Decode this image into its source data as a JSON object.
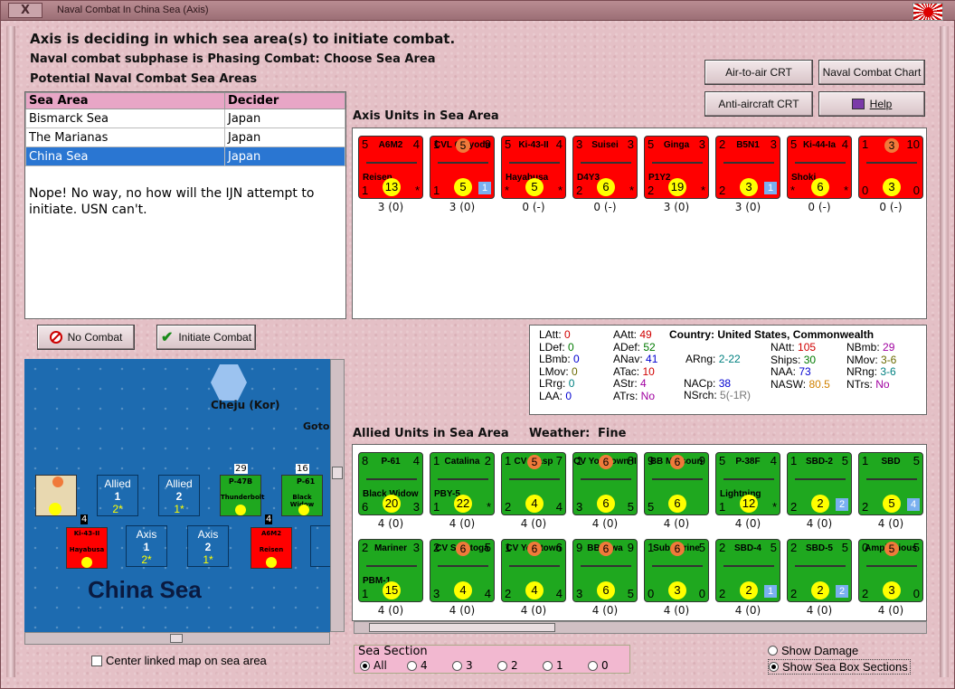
{
  "window": {
    "title": "Naval Combat In China Sea (Axis)",
    "close_label": "X"
  },
  "header": {
    "line1": "Axis is deciding in which sea area(s) to initiate combat.",
    "line2": "Naval combat subphase is Phasing Combat: Choose Sea Area",
    "line3": "Potential Naval Combat Sea Areas"
  },
  "buttons": {
    "air_to_air": "Air-to-air CRT",
    "naval_chart": "Naval Combat Chart",
    "anti_aircraft": "Anti-aircraft CRT",
    "help": "Help",
    "no_combat": "No Combat",
    "initiate_combat": "Initiate Combat"
  },
  "sea_table": {
    "headers": [
      "Sea Area",
      "Decider"
    ],
    "rows": [
      {
        "area": "Bismarck Sea",
        "decider": "Japan"
      },
      {
        "area": "The Marianas",
        "decider": "Japan"
      },
      {
        "area": "China Sea",
        "decider": "Japan"
      }
    ],
    "note": "Nope!  No way, no how will the IJN attempt to initiate.  USN can't."
  },
  "axis_section": {
    "title": "Axis Units in Sea Area"
  },
  "axis_units": [
    {
      "name": "A6M2",
      "sub": "Reisen",
      "tl": "5",
      "tr": "4",
      "bl": "1",
      "br": "*",
      "val": "13",
      "cap": "3 (0)"
    },
    {
      "name": "CVL Chiyoda",
      "sub": "",
      "tl": "1",
      "tr": "9",
      "bl": "1",
      "br": "",
      "val": "5",
      "badge": "1",
      "top": "5",
      "cap": "3 (0)"
    },
    {
      "name": "Ki-43-II",
      "sub": "Hayabusa",
      "tl": "5",
      "tr": "4",
      "bl": "*",
      "br": "*",
      "val": "5",
      "cap": "0 (-)"
    },
    {
      "name": "Suisei",
      "sub": "D4Y3",
      "tl": "3",
      "tr": "3",
      "bl": "2",
      "br": "*",
      "val": "6",
      "cap": "0 (-)"
    },
    {
      "name": "Ginga",
      "sub": "P1Y2",
      "tl": "5",
      "tr": "3",
      "bl": "2",
      "br": "*",
      "val": "19",
      "cap": "3 (0)"
    },
    {
      "name": "B5N1",
      "sub": "",
      "tl": "2",
      "tr": "3",
      "bl": "2",
      "br": "*",
      "val": "3",
      "badge": "1",
      "cap": "3 (0)"
    },
    {
      "name": "Ki-44-Ia",
      "sub": "Shoki",
      "tl": "5",
      "tr": "4",
      "bl": "*",
      "br": "*",
      "val": "6",
      "cap": "0 (-)"
    },
    {
      "name": "",
      "sub": "",
      "tl": "1",
      "tr": "10",
      "bl": "0",
      "br": "0",
      "val": "3",
      "top": "3",
      "cap": "0 (-)"
    }
  ],
  "stats": {
    "col1": [
      {
        "k": "LAtt:",
        "v": "0"
      },
      {
        "k": "LDef:",
        "v": "0"
      },
      {
        "k": "LBmb:",
        "v": "0"
      },
      {
        "k": "LMov:",
        "v": "0"
      },
      {
        "k": "LRrg:",
        "v": "0"
      },
      {
        "k": "LAA:",
        "v": "0"
      }
    ],
    "col2": [
      {
        "k": "AAtt:",
        "v": "49"
      },
      {
        "k": "ADef:",
        "v": "52"
      },
      {
        "k": "ANav:",
        "v": "41"
      },
      {
        "k": "ATac:",
        "v": "10"
      },
      {
        "k": "AStr:",
        "v": "4"
      },
      {
        "k": "ATrs:",
        "v": "No"
      }
    ],
    "country_label": "Country:",
    "country": "United States, Commonwealth",
    "arng_k": "ARng:",
    "arng_v": "2-22",
    "nacp_k": "NACp:",
    "nacp_v": "38",
    "nsrch_k": "NSrch:",
    "nsrch_v": "5(-1R)",
    "col4": [
      {
        "k": "NAtt:",
        "v": "105"
      },
      {
        "k": "Ships:",
        "v": "30"
      },
      {
        "k": "NAA:",
        "v": "73"
      },
      {
        "k": "NASW:",
        "v": "80.5"
      }
    ],
    "col5": [
      {
        "k": "NBmb:",
        "v": "29"
      },
      {
        "k": "NMov:",
        "v": "3-6"
      },
      {
        "k": "NRng:",
        "v": "3-6"
      },
      {
        "k": "NTrs:",
        "v": "No"
      }
    ]
  },
  "allied_section": {
    "title": "Allied Units in Sea Area",
    "weather_label": "Weather:",
    "weather": "Fine"
  },
  "allied_units": [
    {
      "name": "P-61",
      "sub": "Black Widow",
      "tl": "8",
      "tr": "4",
      "bl": "6",
      "br": "3",
      "val": "20",
      "cap": "4 (0)"
    },
    {
      "name": "Catalina",
      "sub": "PBY-5",
      "tl": "1",
      "tr": "2",
      "bl": "1",
      "br": "*",
      "val": "22",
      "cap": "4 (0)"
    },
    {
      "name": "CV Wasp",
      "sub": "",
      "tl": "1",
      "tr": "7",
      "bl": "2",
      "br": "4",
      "val": "4",
      "top": "5",
      "cap": "4 (0)"
    },
    {
      "name": "CV Yorktown II",
      "sub": "",
      "tl": "1",
      "tr": "8",
      "bl": "3",
      "br": "5",
      "val": "6",
      "top": "6",
      "cap": "4 (0)"
    },
    {
      "name": "BB Missouri",
      "sub": "",
      "tl": "9",
      "tr": "9",
      "bl": "5",
      "br": "",
      "val": "6",
      "top": "6",
      "cap": "4 (0)"
    },
    {
      "name": "P-38F",
      "sub": "Lightning",
      "tl": "5",
      "tr": "4",
      "bl": "1",
      "br": "*",
      "val": "12",
      "cap": "4 (0)"
    },
    {
      "name": "SBD-2",
      "sub": "",
      "tl": "1",
      "tr": "5",
      "bl": "2",
      "br": "*",
      "val": "2",
      "badge": "2",
      "cap": "4 (0)"
    },
    {
      "name": "SBD",
      "sub": "",
      "tl": "1",
      "tr": "5",
      "bl": "2",
      "br": "*",
      "val": "5",
      "badge": "4",
      "cap": "4 (0)"
    },
    {
      "name": "Mariner",
      "sub": "PBM-1",
      "tl": "2",
      "tr": "3",
      "bl": "1",
      "br": "",
      "val": "15",
      "cap": "4 (0)"
    },
    {
      "name": "CV Saratoga",
      "sub": "",
      "tl": "2",
      "tr": "5",
      "bl": "3",
      "br": "4",
      "val": "4",
      "top": "6",
      "cap": "4 (0)"
    },
    {
      "name": "CV Yorktown",
      "sub": "",
      "tl": "1",
      "tr": "6",
      "bl": "2",
      "br": "4",
      "val": "4",
      "top": "6",
      "cap": "4 (0)"
    },
    {
      "name": "BB Iowa",
      "sub": "",
      "tl": "9",
      "tr": "9",
      "bl": "3",
      "br": "5",
      "val": "6",
      "top": "6",
      "cap": "4 (0)"
    },
    {
      "name": "Submarine",
      "sub": "",
      "tl": "1",
      "tr": "5",
      "bl": "0",
      "br": "0",
      "val": "3",
      "top": "6",
      "cap": "4 (0)"
    },
    {
      "name": "SBD-4",
      "sub": "",
      "tl": "2",
      "tr": "5",
      "bl": "2",
      "br": "*",
      "val": "2",
      "badge": "1",
      "cap": "4 (0)"
    },
    {
      "name": "SBD-5",
      "sub": "",
      "tl": "2",
      "tr": "5",
      "bl": "2",
      "br": "*",
      "val": "2",
      "badge": "2",
      "cap": "4 (0)"
    },
    {
      "name": "Amphibious",
      "sub": "",
      "tl": "0",
      "tr": "5",
      "bl": "2",
      "br": "0",
      "val": "3",
      "top": "5",
      "cap": "4 (0)"
    }
  ],
  "map": {
    "location": "Cheju (Kor)",
    "goto": "Goto",
    "sea_name": "China Sea",
    "boxes": [
      {
        "label": "Allied",
        "num": "1",
        "sub": "2*"
      },
      {
        "label": "Allied",
        "num": "2",
        "sub": "1*"
      },
      {
        "label": "Axis",
        "num": "1",
        "sub": "2*"
      },
      {
        "label": "Axis",
        "num": "2",
        "sub": "1*"
      }
    ],
    "stack_counts": [
      "29",
      "16",
      "4",
      "4"
    ],
    "unit_names": [
      "P-47B",
      "Thunderbolt",
      "P-61",
      "Black Widow",
      "Ki-43-II",
      "Hayabusa",
      "A6M2",
      "Reisen"
    ]
  },
  "controls": {
    "center_map": "Center linked map on sea area",
    "sea_section_label": "Sea Section",
    "sea_options": [
      "All",
      "4",
      "3",
      "2",
      "1",
      "0"
    ],
    "show_damage": "Show Damage",
    "show_sections": "Show Sea Box Sections"
  }
}
